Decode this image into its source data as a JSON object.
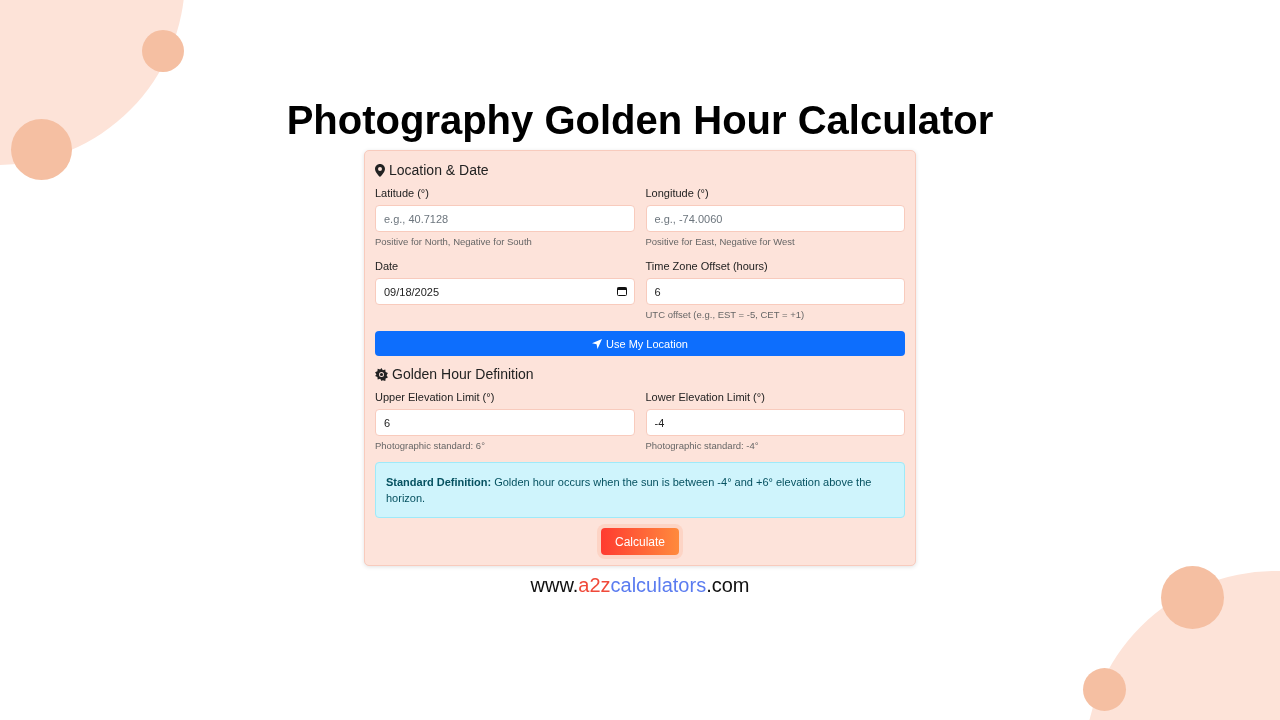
{
  "title": "Photography Golden Hour Calculator",
  "sections": [
    {
      "heading": "Location & Date",
      "fields": [
        {
          "label": "Latitude (°)",
          "placeholder": "e.g., 40.7128",
          "hint": "Positive for North, Negative for South",
          "kind": "text"
        },
        {
          "label": "Longitude (°)",
          "placeholder": "e.g., -74.0060",
          "hint": "Positive for East, Negative for West",
          "kind": "text"
        },
        {
          "label": "Date",
          "value": "09/18/2025",
          "kind": "date"
        },
        {
          "label": "Time Zone Offset (hours)",
          "value": "6",
          "hint": "UTC offset (e.g., EST = -5, CET = +1)",
          "kind": "text"
        }
      ],
      "action": {
        "label": "Use My Location"
      }
    },
    {
      "heading": "Golden Hour Definition",
      "fields": [
        {
          "label": "Upper Elevation Limit (°)",
          "value": "6",
          "hint": "Photographic standard: 6°",
          "kind": "text"
        },
        {
          "label": "Lower Elevation Limit (°)",
          "value": "-4",
          "hint": "Photographic standard: -4°",
          "kind": "text"
        }
      ],
      "note": "**Standard Definition:** Golden hour occurs when the sun is between -4° and +6° elevation above the horizon."
    }
  ],
  "submit": "Calculate",
  "footer": [
    {
      "text": "www.",
      "color": "#111111"
    },
    {
      "text": "a2z",
      "color": "#f04a3a"
    },
    {
      "text": "calculators",
      "color": "#5b7cf0"
    },
    {
      "text": ".com",
      "color": "#111111"
    }
  ]
}
